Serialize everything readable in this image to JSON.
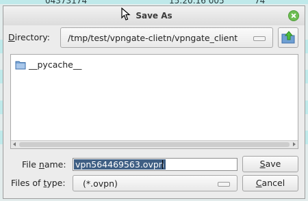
{
  "background": {
    "fragments": [
      "04373174",
      "15:20:16 005",
      "74"
    ]
  },
  "dialog": {
    "title": "Save As",
    "close_icon": "close-icon",
    "directory": {
      "label_pre": "",
      "label_mnemonic": "D",
      "label_post": "irectory:",
      "path": "/tmp/test/vpngate-clietn/vpngate_client"
    },
    "up_button_icon": "folder-up-icon",
    "files": [
      {
        "name": "__pycache__",
        "icon": "folder-icon"
      }
    ],
    "file_name": {
      "label_pre": "File ",
      "label_mnemonic": "n",
      "label_post": "ame:",
      "value": "vpn564469563.ovpn"
    },
    "file_type": {
      "label_pre": "Files of ",
      "label_mnemonic": "t",
      "label_post": "ype:",
      "value": "(*.ovpn)"
    },
    "save_button": {
      "mnemonic": "S",
      "rest": "ave"
    },
    "cancel_button": {
      "mnemonic": "C",
      "rest": "ancel"
    },
    "accent": "#3f5f84",
    "close_color": "#6dbd52"
  }
}
